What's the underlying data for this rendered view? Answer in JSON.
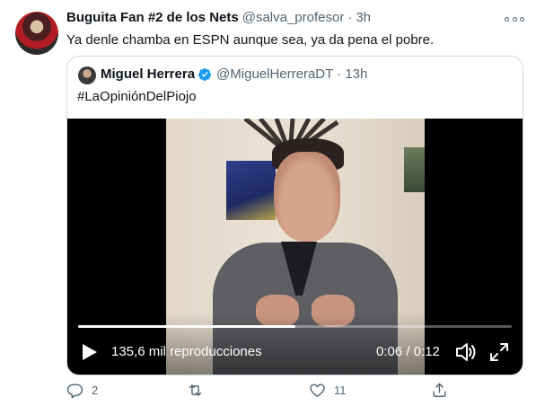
{
  "tweet": {
    "author_name": "Buguita Fan #2 de los Nets",
    "author_handle": "@salva_profesor",
    "separator": "·",
    "time": "3h",
    "text": "Ya denle chamba en ESPN aunque sea, ya da pena el pobre."
  },
  "quote": {
    "author_name": "Miguel Herrera",
    "author_handle": "@MiguelHerreraDT",
    "separator": "·",
    "time": "13h",
    "text": "#LaOpiniónDelPiojo",
    "verified_icon": "verified-badge-icon",
    "verified_color": "#1d9bf0"
  },
  "video": {
    "views": "135,6 mil reproducciones",
    "timecode": "0:06 / 0:12",
    "progress": 0.5
  },
  "actions": {
    "reply_count": "2",
    "retweet_count": "",
    "like_count": "11"
  },
  "colors": {
    "text": "#0f1419",
    "secondary": "#536471",
    "border": "#cfd9de"
  }
}
